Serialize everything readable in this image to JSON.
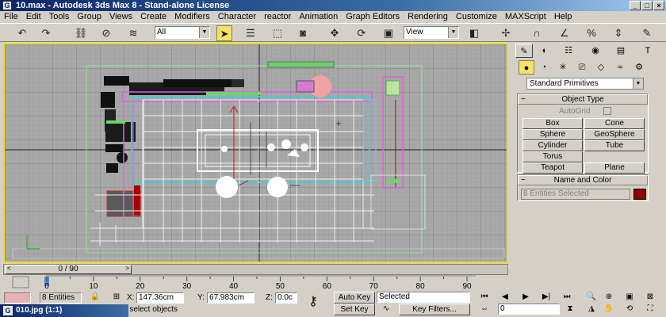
{
  "window": {
    "title": "10.max - Autodesk 3ds Max 8 - Stand-alone License",
    "app_icon": "G"
  },
  "menu": [
    "File",
    "Edit",
    "Tools",
    "Group",
    "Views",
    "Create",
    "Modifiers",
    "Character",
    "reactor",
    "Animation",
    "Graph Editors",
    "Rendering",
    "Customize",
    "MAXScript",
    "Help"
  ],
  "toolbar": {
    "selection_filter": "All",
    "reference_coord": "View"
  },
  "command_panel": {
    "category": "Standard Primitives",
    "object_type": {
      "title": "Object Type",
      "autogrid_label": "AutoGrid",
      "buttons": [
        "Box",
        "Cone",
        "Sphere",
        "GeoSphere",
        "Cylinder",
        "Tube",
        "Torus",
        "",
        "Teapot",
        "Plane"
      ]
    },
    "name_and_color": {
      "title": "Name and Color",
      "name_value": "8 Entities Selected",
      "color": "#8b0000"
    }
  },
  "time_slider": {
    "label": "0 / 90",
    "prev": "<",
    "next": ">"
  },
  "track_ticks": [
    "0",
    "10",
    "20",
    "30",
    "40",
    "50",
    "60",
    "70",
    "80",
    "90"
  ],
  "status": {
    "selection_count": "8 Entities",
    "x_label": "X:",
    "x_value": "147.36cm",
    "y_label": "Y:",
    "y_value": "67.983cm",
    "z_label": "Z:",
    "z_value": "0.0c",
    "prompt": "o select objects",
    "auto_key": "Auto Key",
    "set_key": "Set Key",
    "key_mode": "Selected",
    "key_filters": "Key Filters...",
    "frame": "0"
  },
  "taskbar": {
    "icon": "G",
    "label": "010.jpg (1:1)"
  }
}
